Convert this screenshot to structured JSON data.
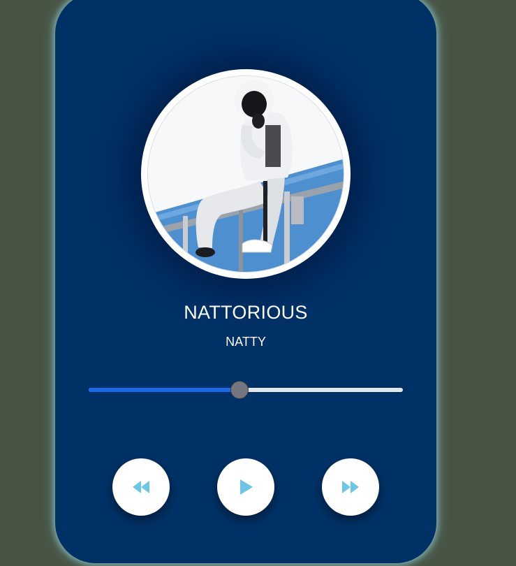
{
  "track": {
    "title": "NATTORIOUS",
    "artist": "NATTY"
  },
  "progress": {
    "fraction": 0.48
  },
  "controls": {
    "prev_icon": "rewind-icon",
    "play_icon": "play-icon",
    "next_icon": "fast-forward-icon"
  },
  "colors": {
    "page_background": "#485444",
    "card_background": "#003166",
    "progress_fill": "#1a68e8",
    "icon_accent": "#6cc6e4"
  }
}
